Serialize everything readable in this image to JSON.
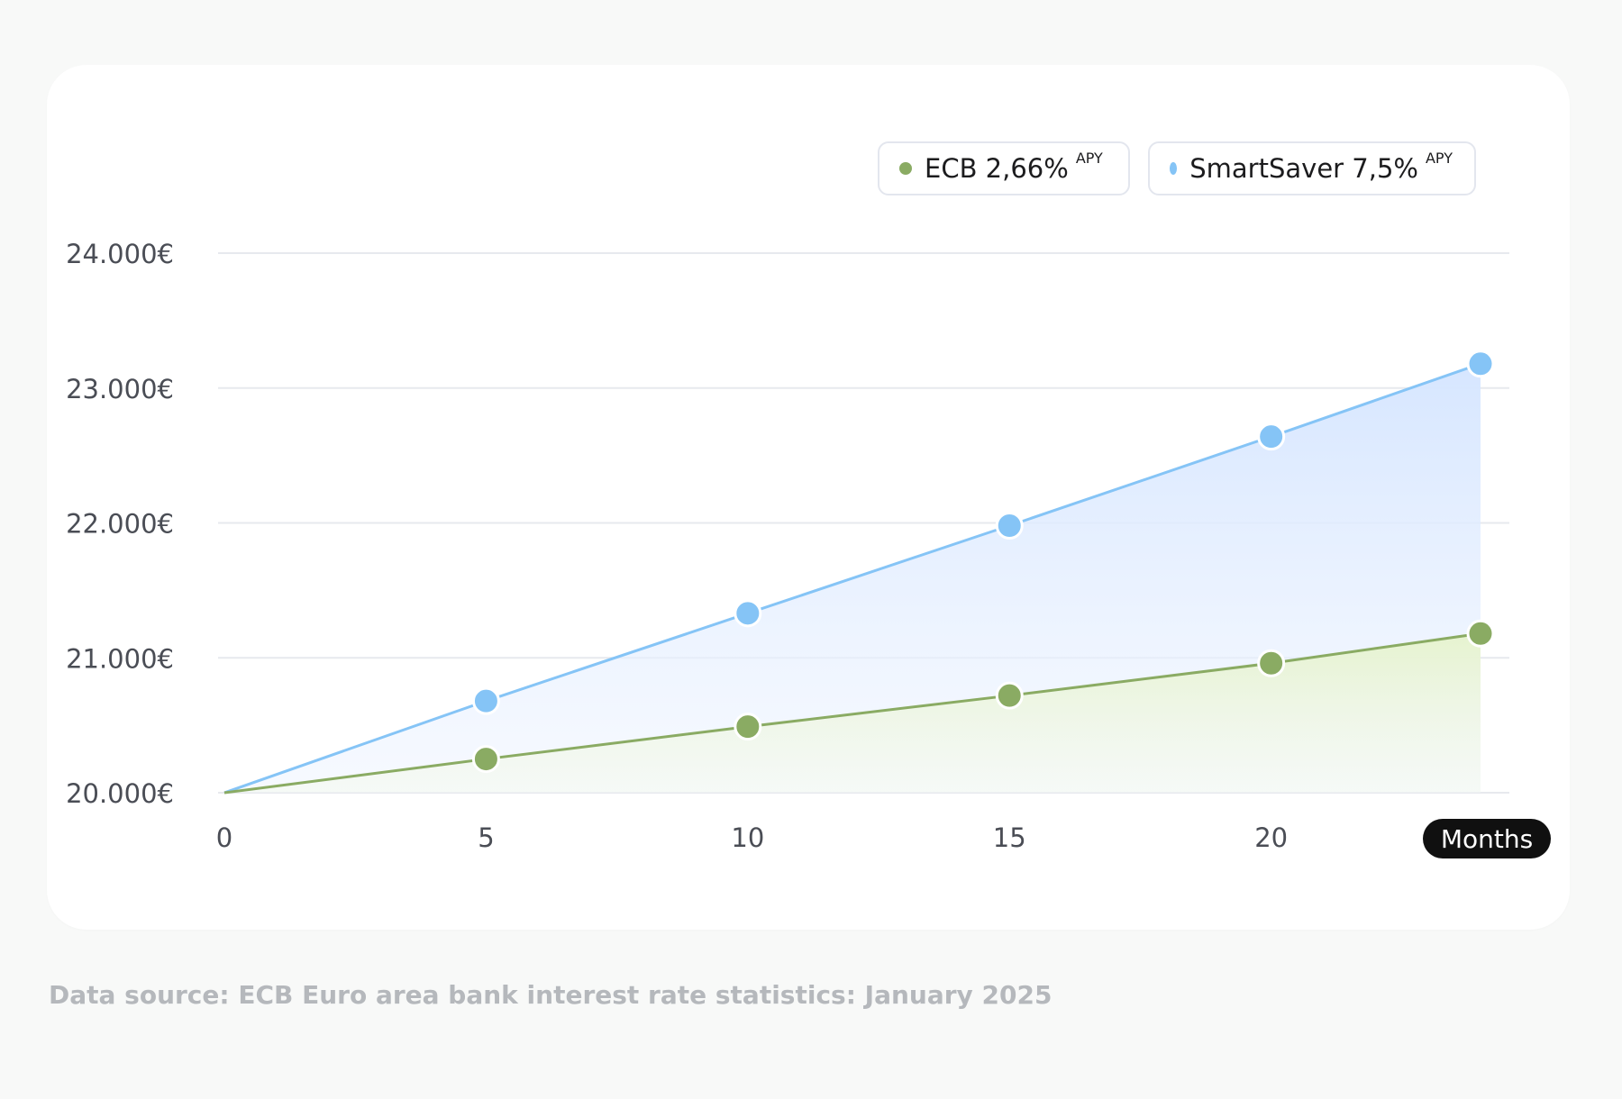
{
  "legend": [
    {
      "label": "ECB 2,66%",
      "sup": "APY",
      "color": "#8aab63"
    },
    {
      "label": "SmartSaver 7,5%",
      "sup": "APY",
      "color": "#85c4f6"
    }
  ],
  "x_axis_unit": "Months",
  "source_note": "Data source: ECB Euro area bank interest rate statistics: January 2025",
  "chart_data": {
    "type": "area",
    "title": "",
    "xlabel": "Months",
    "ylabel": "",
    "x_ticks": [
      "0",
      "5",
      "10",
      "15",
      "20"
    ],
    "y_ticks": [
      "20.000€",
      "21.000€",
      "22.000€",
      "23.000€",
      "24.000€"
    ],
    "y_tick_values": [
      20000,
      21000,
      22000,
      23000,
      24000
    ],
    "xlim": [
      0,
      25
    ],
    "ylim": [
      20000,
      24000
    ],
    "grid": true,
    "legend_position": "top-right",
    "series": [
      {
        "name": "SmartSaver 7,5% APY",
        "color": "#85c4f6",
        "fill": "#d6e6ff",
        "points": [
          [
            0,
            20000
          ],
          [
            5,
            20680
          ],
          [
            10,
            21330
          ],
          [
            15,
            21980
          ],
          [
            20,
            22640
          ],
          [
            24,
            23180
          ]
        ]
      },
      {
        "name": "ECB 2,66% APY",
        "color": "#8aab63",
        "fill": "#e6f3cf",
        "points": [
          [
            0,
            20000
          ],
          [
            5,
            20250
          ],
          [
            10,
            20490
          ],
          [
            15,
            20720
          ],
          [
            20,
            20960
          ],
          [
            24,
            21180
          ]
        ]
      }
    ]
  }
}
